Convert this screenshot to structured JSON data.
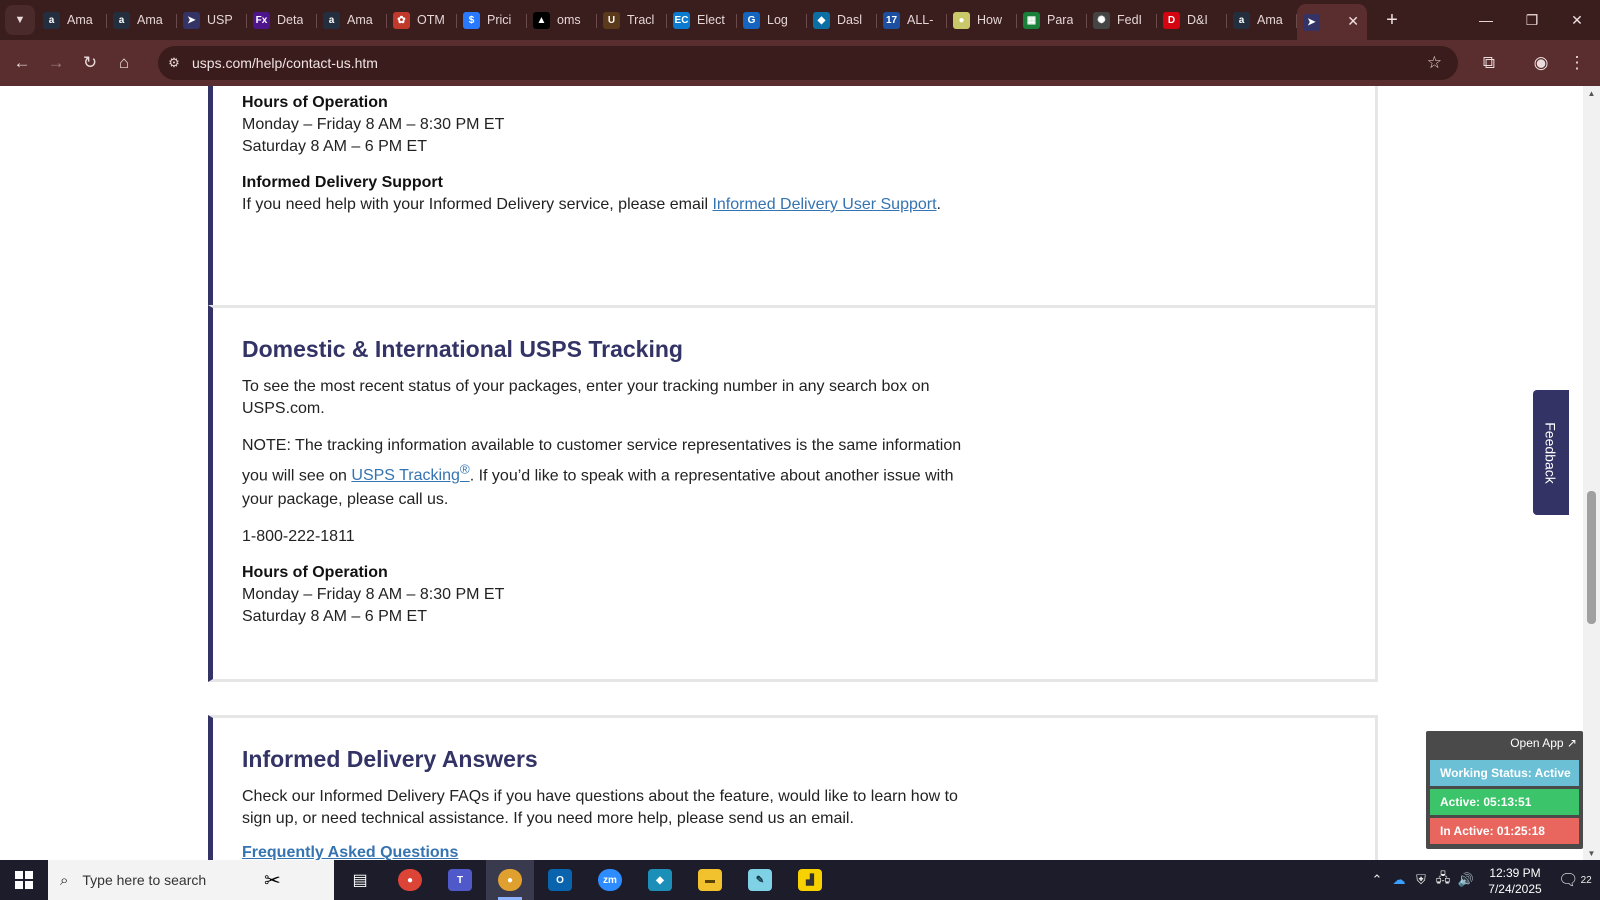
{
  "browser": {
    "tabs": [
      {
        "label": "Ama",
        "icon": "amazon-icon",
        "color": "#232f3e",
        "glyph": "a"
      },
      {
        "label": "Ama",
        "icon": "amazon-icon",
        "color": "#232f3e",
        "glyph": "a"
      },
      {
        "label": "USP",
        "icon": "usps-icon",
        "color": "#333366",
        "glyph": "➤"
      },
      {
        "label": "Deta",
        "icon": "fedex-icon",
        "color": "#4d148c",
        "glyph": "Fx"
      },
      {
        "label": "Ama",
        "icon": "amazon-icon",
        "color": "#232f3e",
        "glyph": "a"
      },
      {
        "label": "OTM",
        "icon": "otm-icon",
        "color": "#c0392b",
        "glyph": "✿"
      },
      {
        "label": "Prici",
        "icon": "dollar-icon",
        "color": "#2979ff",
        "glyph": "$"
      },
      {
        "label": "oms",
        "icon": "triangle-icon",
        "color": "#000000",
        "glyph": "▲"
      },
      {
        "label": "Tracl",
        "icon": "ups-icon",
        "color": "#5a3a1a",
        "glyph": "U"
      },
      {
        "label": "Elect",
        "icon": "ec-icon",
        "color": "#0a7bd1",
        "glyph": "EC"
      },
      {
        "label": "Log",
        "icon": "login-icon",
        "color": "#1565c0",
        "glyph": "G"
      },
      {
        "label": "Dasl",
        "icon": "dashboard-icon",
        "color": "#0b6fa4",
        "glyph": "◆"
      },
      {
        "label": "ALL-",
        "icon": "17track-icon",
        "color": "#1d4fa0",
        "glyph": "17"
      },
      {
        "label": "How",
        "icon": "how-icon",
        "color": "#c9c96a",
        "glyph": "●"
      },
      {
        "label": "Para",
        "icon": "sheets-icon",
        "color": "#188038",
        "glyph": "▦"
      },
      {
        "label": "FedI",
        "icon": "openai-icon",
        "color": "#444444",
        "glyph": "✺"
      },
      {
        "label": "D&I",
        "icon": "dhl-icon",
        "color": "#d40511",
        "glyph": "D"
      },
      {
        "label": "Ama",
        "icon": "amazon-icon",
        "color": "#232f3e",
        "glyph": "a"
      }
    ],
    "active_tab": {
      "icon": "usps-icon",
      "close": "✕"
    },
    "url": "usps.com/help/contact-us.htm"
  },
  "page": {
    "card1": {
      "hours_heading": "Hours of Operation",
      "hours_weekday": "Monday – Friday 8 AM – 8:30 PM ET",
      "hours_saturday": "Saturday 8 AM – 6 PM ET",
      "support_heading": "Informed Delivery Support",
      "support_text_pre": "If you need help with your Informed Delivery service, please email ",
      "support_link": "Informed Delivery User Support",
      "support_text_post": "."
    },
    "card2": {
      "title": "Domestic & International USPS Tracking",
      "intro": "To see the most recent status of your packages, enter your tracking number in any search box on USPS.com.",
      "note_pre": "NOTE: The tracking information available to customer service representatives is the same information you will see on ",
      "note_link": "USPS Tracking",
      "note_link_sup": "®",
      "note_post": ". If you’d like to speak with a representative about another issue with your package, please call us.",
      "phone": "1-800-222-1811",
      "hours_heading": "Hours of Operation",
      "hours_weekday": "Monday – Friday 8 AM – 8:30 PM ET",
      "hours_saturday": "Saturday 8 AM – 6 PM ET"
    },
    "card3": {
      "title": "Informed Delivery Answers",
      "text": "Check our Informed Delivery FAQs if you have questions about the feature, would like to learn how to sign up, or need technical assistance. If you need more help, please send us an email.",
      "faq_link": "Frequently Asked Questions"
    },
    "feedback_label": "Feedback"
  },
  "widget": {
    "open_app": "Open App ↗",
    "working_status": "Working Status: Active",
    "active": "Active: 05:13:51",
    "inactive": "In Active: 01:25:18",
    "colors": {
      "working": "#6cc0d6",
      "active": "#3cc46a",
      "inactive": "#e8665e"
    }
  },
  "taskbar": {
    "search_placeholder": "Type here to search",
    "time": "12:39 PM",
    "date": "7/24/2025",
    "notification_count": "22"
  }
}
